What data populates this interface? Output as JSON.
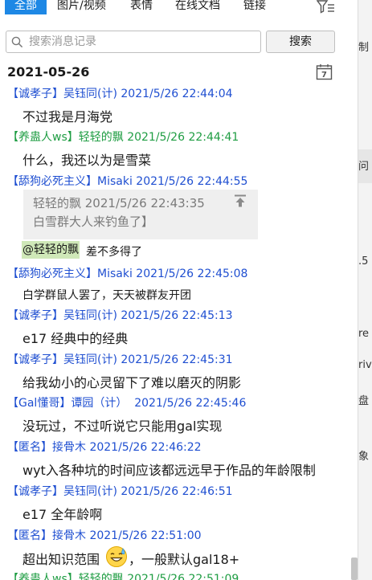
{
  "tabs": [
    {
      "label": "全部",
      "active": true
    },
    {
      "label": "图片/视频",
      "active": false
    },
    {
      "label": "表情",
      "active": false
    },
    {
      "label": "在线文档",
      "active": false
    },
    {
      "label": "链接",
      "active": false
    }
  ],
  "search": {
    "placeholder": "搜索消息记录",
    "button_label": "搜索"
  },
  "date_header": "2021-05-26",
  "calendar_day": "7",
  "messages": [
    {
      "tag": "【诚孝子】",
      "sender": "吴钰同(计)",
      "time": "2021/5/26 22:44:04",
      "text": "不过我是月海党"
    },
    {
      "tag": "【养蛊人ws】",
      "sender": "轻轻的飘",
      "time": "2021/5/26 22:44:41",
      "text": "什么，我还以为是雪菜"
    },
    {
      "tag": "【舔狗必死主义】",
      "sender": "Misaki",
      "time": "2021/5/26 22:44:55",
      "quote_meta": "轻轻的飘  2021/5/26 22:43:35",
      "quote_text": "白雪群大人来钓鱼了】",
      "mention": "@轻轻的飘",
      "text": "差不多得了"
    },
    {
      "tag": "【舔狗必死主义】",
      "sender": "Misaki",
      "time": "2021/5/26 22:45:08",
      "text": "白学群鼠人罢了，天天被群友开团"
    },
    {
      "tag": "【诚孝子】",
      "sender": "吴钰同(计)",
      "time": "2021/5/26 22:45:13",
      "text": "e17 经典中的经典"
    },
    {
      "tag": "【诚孝子】",
      "sender": "吴钰同(计)",
      "time": "2021/5/26 22:45:31",
      "text": "给我幼小的心灵留下了难以磨灭的阴影"
    },
    {
      "tag": "【Gal懂哥】",
      "sender": "谭园（计）",
      "time": "2021/5/26 22:45:46",
      "text": "没玩过，不过听说它只能用gal实现"
    },
    {
      "tag": "【匿名】",
      "sender": "接骨木",
      "time": "2021/5/26 22:46:22",
      "text": "wyt入各种坑的时间应该都远远早于作品的年龄限制"
    },
    {
      "tag": "【诚孝子】",
      "sender": "吴钰同(计)",
      "time": "2021/5/26 22:46:51",
      "text": "e17 全年龄啊"
    },
    {
      "tag": "【匿名】",
      "sender": "接骨木",
      "time": "2021/5/26 22:51:00",
      "text_before_emoji": "超出知识范围",
      "text_after_emoji": "，一般默认gal18+"
    },
    {
      "tag": "【养蛊人ws】",
      "sender": "轻轻的飘",
      "time": "2021/5/26 22:51:09",
      "text": ""
    }
  ],
  "right_strip": [
    "制",
    "问",
    ".5",
    "re",
    "riv",
    "盘",
    "象"
  ],
  "colors": {
    "accent": "#1e88e5",
    "sender_blue": "#1f4fd1",
    "sender_green": "#1f9d43",
    "mention_bg": "#cfe8b8",
    "quote_bg": "#efefef"
  }
}
